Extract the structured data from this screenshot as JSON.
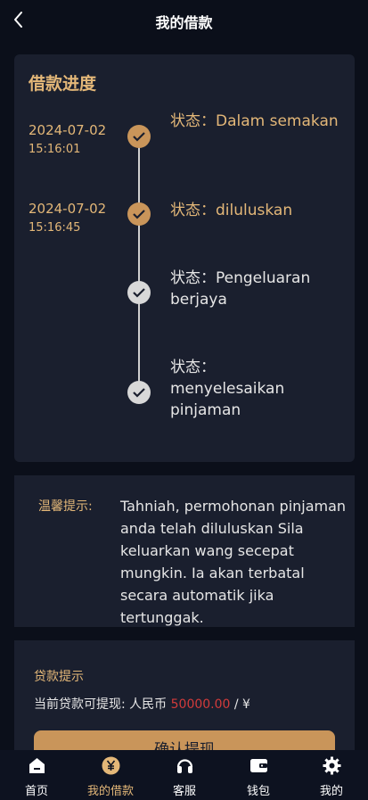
{
  "header": {
    "title": "我的借款"
  },
  "progress": {
    "title": "借款进度",
    "steps": [
      {
        "date": "2024-07-02",
        "time": "15:16:01",
        "status": "状态：Dalam semakan",
        "done": true
      },
      {
        "date": "2024-07-02",
        "time": "15:16:45",
        "status": "状态：diluluskan",
        "done": true
      },
      {
        "date": "",
        "time": "",
        "status": "状态：Pengeluaran berjaya",
        "done": false
      },
      {
        "date": "",
        "time": "",
        "status": "状态：menyelesaikan pinjaman",
        "done": false
      }
    ]
  },
  "tips": {
    "label": "温馨提示:",
    "text": "Tahniah, permohonan pinjaman anda telah diluluskan Sila keluarkan wang secepat mungkin. Ia akan terbatal secara automatik jika tertunggak."
  },
  "loan": {
    "title": "贷款提示",
    "line_prefix": "当前贷款可提现: 人民币",
    "amount": "50000.00",
    "line_suffix": "/ ¥",
    "button": "确认提现"
  },
  "tabbar": {
    "items": [
      {
        "label": "首页",
        "icon": "home-icon"
      },
      {
        "label": "我的借款",
        "icon": "yuan-icon",
        "active": true
      },
      {
        "label": "客服",
        "icon": "headset-icon"
      },
      {
        "label": "钱包",
        "icon": "wallet-icon"
      },
      {
        "label": "我的",
        "icon": "gear-icon"
      }
    ]
  },
  "colors": {
    "accent": "#e3b778",
    "done": "#c9955a",
    "pending": "#d8d8d8",
    "amount": "#d23b3b"
  }
}
